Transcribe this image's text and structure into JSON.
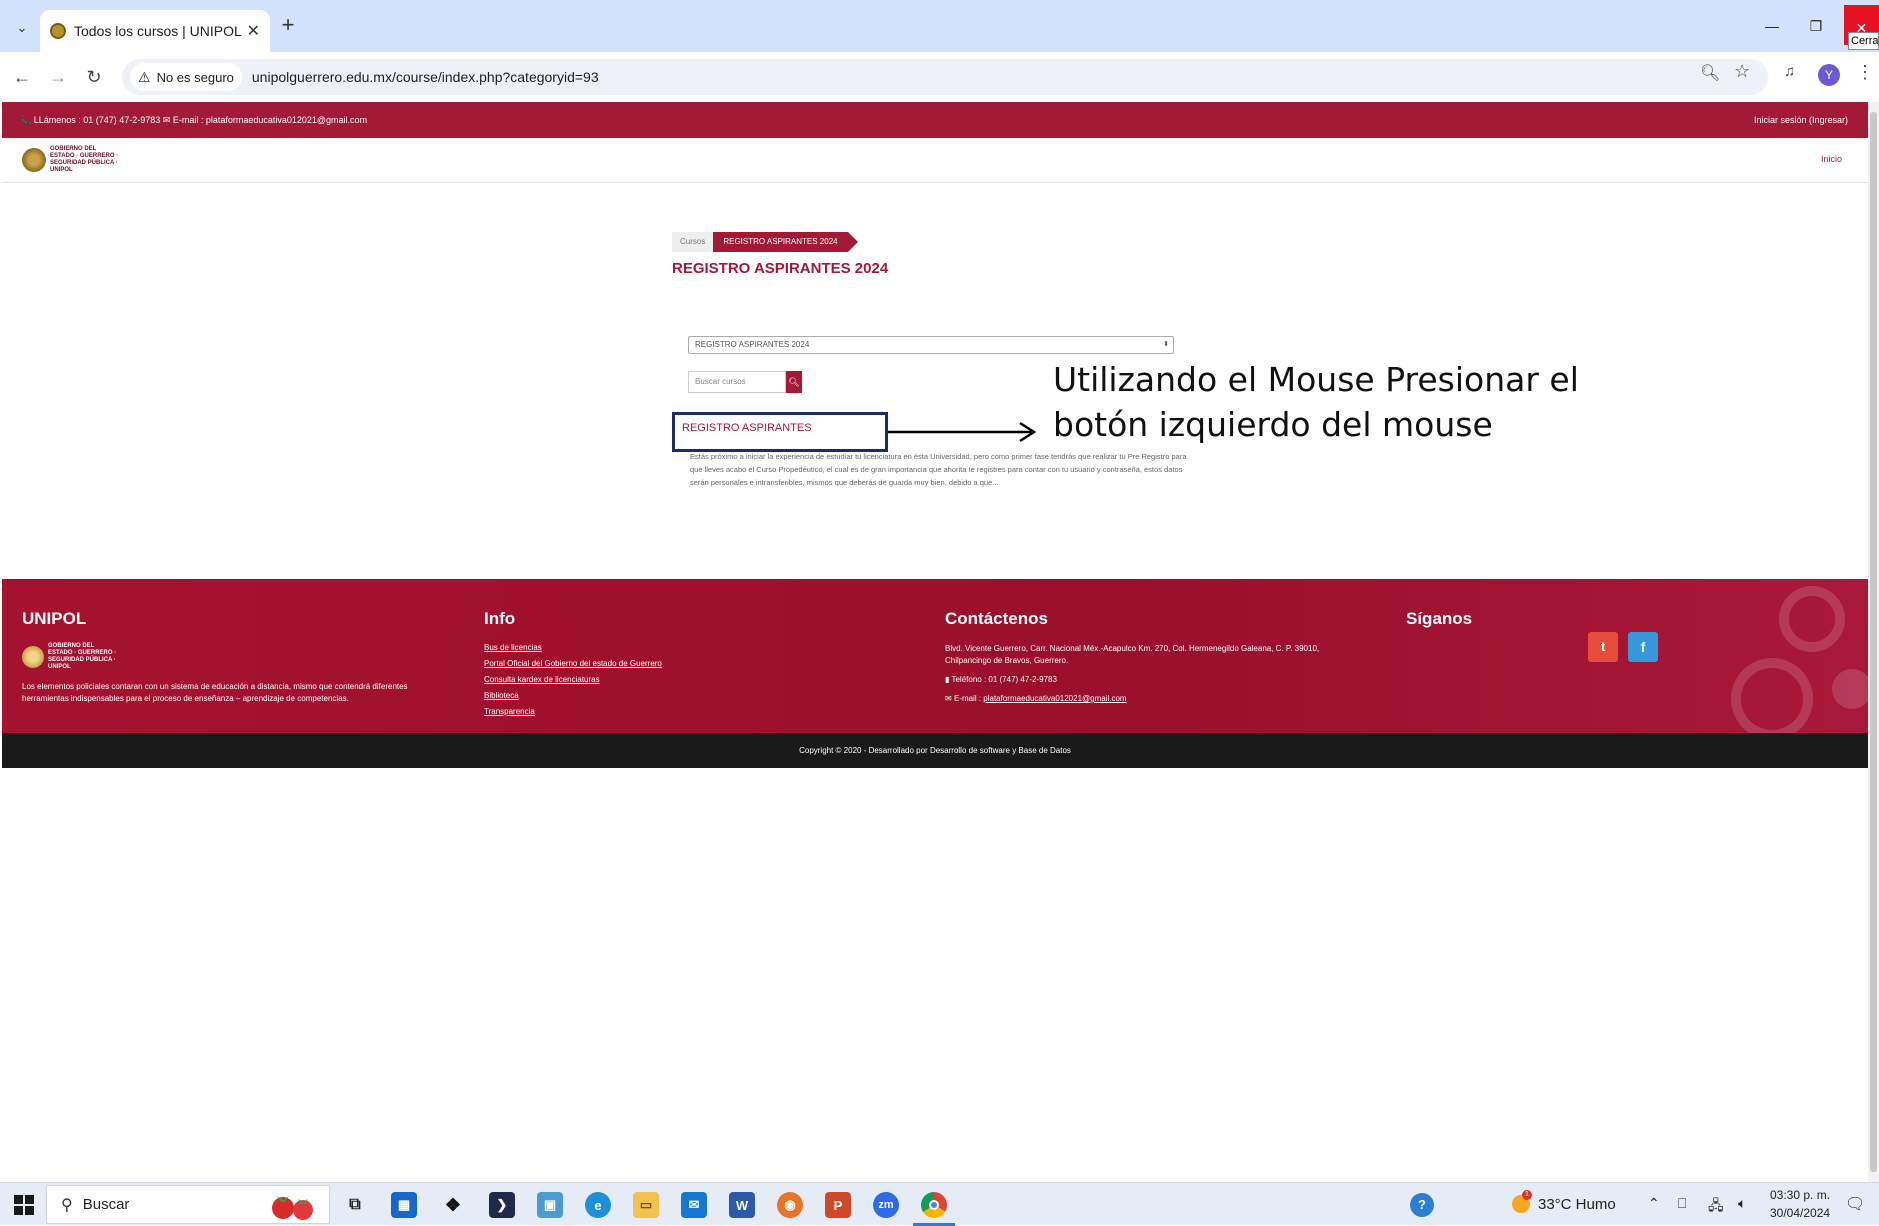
{
  "browser": {
    "tab_title": "Todos los cursos | UNIPOL",
    "tab_close": "✕",
    "new_tab": "+",
    "security_label": "No es seguro",
    "url": "unipolguerrero.edu.mx/course/index.php?categoryid=93",
    "profile_initial": "Y",
    "close_tooltip": "Cerrar"
  },
  "site": {
    "contact_bar": "📞 LLámenos : 01 (747) 47-2-9783  ✉ E-mail : plataformaeducativa012021@gmail.com",
    "login_link": "Iniciar sesión (Ingresar)",
    "nav_home": "Inicio",
    "logo_text": "GOBIERNO DEL ESTADO · GUERRERO · SEGURIDAD PÚBLICA · UNIPOL"
  },
  "main": {
    "breadcrumb_root": "Cursos",
    "breadcrumb_current": "REGISTRO ASPIRANTES 2024",
    "page_title": "REGISTRO ASPIRANTES 2024",
    "category_select_value": "REGISTRO ASPIRANTES 2024",
    "search_placeholder": "Buscar cursos",
    "course_name": "REGISTRO ASPIRANTES",
    "course_summary": "Estás próximo a iniciar la experiencia de estudiar tu licenciatura en ésta Universidad, pero como primer fase tendrás que realizar tu Pre Registro para que lleves acabo el Curso Propedéutico, el cual es de gran importancia que ahorita te registres para contar con tu usuario y contraseña, estos datos serán personales  e intransferibles, mismos que deberás de guarda muy bien, debido a que..."
  },
  "annotation": {
    "line1": "Utilizando el Mouse Presionar el",
    "line2": "botón izquierdo del mouse"
  },
  "footer": {
    "col1_title": "UNIPOL",
    "col1_text": "Los elementos policiales contaran con un sistema de educación a distancia, mismo que contendrá diferentes herramientas indispensables para el proceso de enseñanza – aprendizaje de competencias.",
    "col2_title": "Info",
    "col2_links": [
      "Bus de licencias",
      "Portal Oficial del Gobierno del estado de Guerrero",
      "Consulta kardex de licenciaturas",
      "Biblioteca",
      "Transparencia"
    ],
    "col3_title": "Contáctenos",
    "col3_address": "Blvd. Vicente Guerrero, Carr. Nacional Méx.-Acapulco Km. 270, Col. Hermenegildo Galeana, C. P. 39010, Chilpancingo de Bravos, Guerrero.",
    "col3_phone": "Teléfono : 01 (747) 47-2-9783",
    "col3_email_label": "E-mail : ",
    "col3_email": "plataformaeducativa012021@gmail.com",
    "col4_title": "Síganos",
    "twitter_glyph": "t",
    "facebook_glyph": "f",
    "copyright": "Copyright © 2020 - Desarrollado por Desarrollo de software y Base de Datos"
  },
  "taskbar": {
    "search_placeholder": "Buscar",
    "weather": "33°C  Humo",
    "weather_badge": "1",
    "time": "03:30 p. m.",
    "date": "30/04/2024"
  },
  "colors": {
    "brand": "#a31a36",
    "annotation_box": "#1b2b6b"
  }
}
